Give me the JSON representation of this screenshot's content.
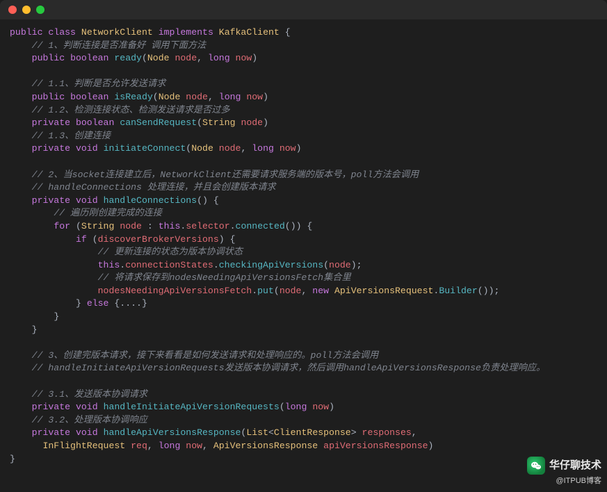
{
  "window": {
    "buttons": [
      "close",
      "minimize",
      "zoom"
    ]
  },
  "code": {
    "l1": {
      "t1": "public",
      "t2": "class",
      "t3": "NetworkClient",
      "t4": "implements",
      "t5": "KafkaClient",
      "brace": "{"
    },
    "c1": "// 1、判断连接是否准备好 调用下面方法",
    "l2": {
      "mod": "public",
      "ret": "boolean",
      "name": "ready",
      "p1t": "Node",
      "p1n": "node",
      "p2t": "long",
      "p2n": "now"
    },
    "c11": "// 1.1、判断是否允许发送请求",
    "l3": {
      "mod": "public",
      "ret": "boolean",
      "name": "isReady",
      "p1t": "Node",
      "p1n": "node",
      "p2t": "long",
      "p2n": "now"
    },
    "c12a": "// 1.2、检测连接状态、检测发送请求是否过多",
    "l4": {
      "mod": "private",
      "ret": "boolean",
      "name": "canSendRequest",
      "p1t": "String",
      "p1n": "node"
    },
    "c13": "// 1.3、创建连接",
    "l5": {
      "mod": "private",
      "ret": "void",
      "name": "initiateConnect",
      "p1t": "Node",
      "p1n": "node",
      "p2t": "long",
      "p2n": "now"
    },
    "c2a": "// 2、当socket连接建立后，NetworkClient还需要请求服务端的版本号，poll方法会调用",
    "c2b": "// handleConnections 处理连接，并且会创建版本请求",
    "l6": {
      "mod": "private",
      "ret": "void",
      "name": "handleConnections"
    },
    "c_iter": "// 遍历刚创建完成的连接",
    "l7": {
      "kw": "for",
      "pOpen": "(",
      "type": "String",
      "var": "node",
      "colon": ":",
      "thiskw": "this",
      "dot": ".",
      "prop": "selector",
      "call": "connected",
      "pClose": ") {"
    },
    "l8": {
      "kw": "if",
      "var": "discoverBrokerVersions"
    },
    "c_upd": "// 更新连接的状态为版本协调状态",
    "l9": {
      "thiskw": "this",
      "prop": "connectionStates",
      "call": "checkingApiVersions",
      "arg": "node"
    },
    "c_save": "// 将请求保存到nodesNeedingApiVersionsFetch集合里",
    "l10": {
      "obj": "nodesNeedingApiVersionsFetch",
      "call": "put",
      "arg1": "node",
      "newkw": "new",
      "cls": "ApiVersionsRequest",
      "builder": "Builder"
    },
    "l11": {
      "close": "}",
      "elsekw": "else",
      "rest": "{....}"
    },
    "c3a": "// 3、创建完版本请求，接下来看看是如何发送请求和处理响应的。poll方法会调用",
    "c3b": "// handleInitiateApiVersionRequests发送版本协调请求，然后调用handleApiVersionsResponse负责处理响应。",
    "c31": "// 3.1、发送版本协调请求",
    "l12": {
      "mod": "private",
      "ret": "void",
      "name": "handleInitiateApiVersionRequests",
      "p1t": "long",
      "p1n": "now"
    },
    "c32": "// 3.2、处理版本协调响应",
    "l13": {
      "mod": "private",
      "ret": "void",
      "name": "handleApiVersionsResponse",
      "p1t": "List",
      "p1g": "ClientResponse",
      "p1n": "responses"
    },
    "l13b": {
      "p2t": "InFlightRequest",
      "p2n": "req",
      "p3t": "long",
      "p3n": "now",
      "p4t": "ApiVersionsResponse",
      "p4n": "apiVersionsResponse"
    }
  },
  "watermark": {
    "line1": "华仔聊技术",
    "line2": "@ITPUB博客",
    "icon": "wechat-icon"
  }
}
